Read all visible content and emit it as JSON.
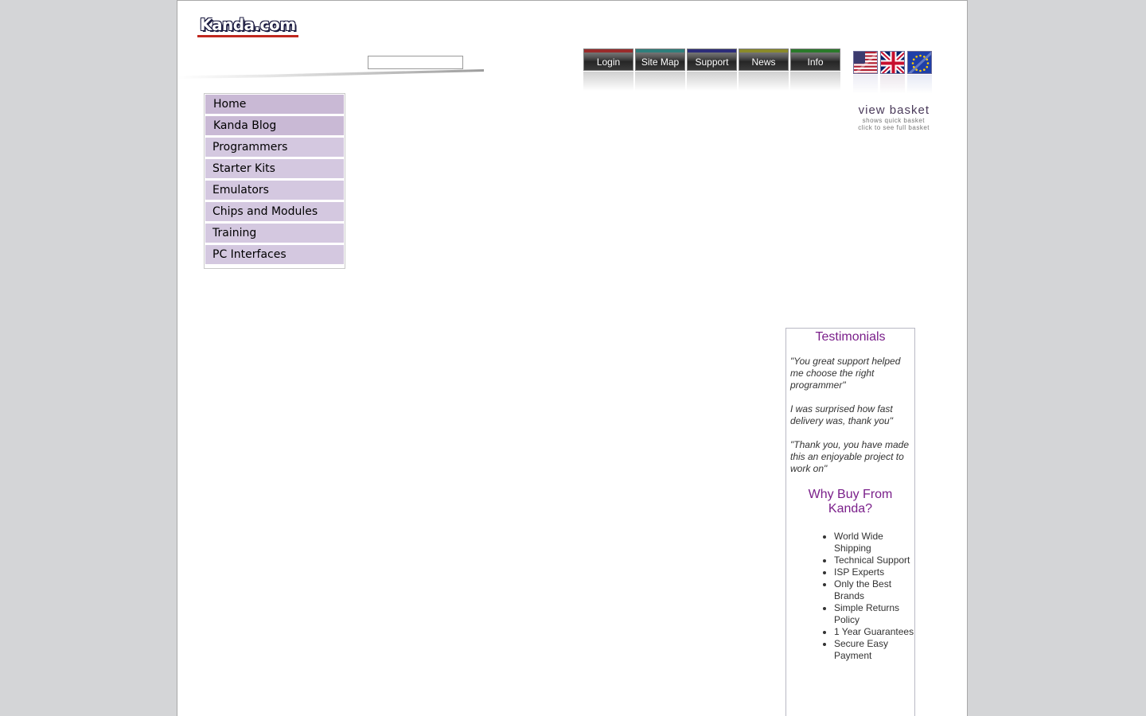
{
  "header": {
    "logo_text": "Kanda.com",
    "search_value": ""
  },
  "topnav": [
    {
      "label": "Login",
      "accent": "#9a2b2b"
    },
    {
      "label": "Site Map",
      "accent": "#2f7f7c"
    },
    {
      "label": "Support",
      "accent": "#2c2c7a"
    },
    {
      "label": "News",
      "accent": "#8a8a2a"
    },
    {
      "label": "Info",
      "accent": "#2a7a2a"
    }
  ],
  "flags": [
    {
      "icon": "us-flag-icon"
    },
    {
      "icon": "uk-flag-icon"
    },
    {
      "icon": "eu-flag-icon"
    }
  ],
  "basket": {
    "title": "view basket",
    "line1": "shows quick basket",
    "line2": "click to see full basket"
  },
  "menu": {
    "items": [
      "Home",
      "Kanda Blog",
      "Programmers",
      "Starter Kits",
      "Emulators",
      "Chips and Modules",
      "Training",
      "PC Interfaces"
    ]
  },
  "testimonials": {
    "heading": "Testimonials",
    "quotes": [
      "\"You great support helped me choose the right programmer\"",
      "I was surprised how fast delivery was, thank you\"",
      "\"Thank you, you have made this an enjoyable project to work on\""
    ]
  },
  "why": {
    "heading": "Why Buy From Kanda?",
    "items": [
      "World Wide Shipping",
      "Technical Support",
      "ISP Experts",
      "Only the Best Brands",
      "Simple Returns Policy",
      "1 Year Guarantees",
      "Secure Easy Payment"
    ]
  },
  "colors": {
    "menu_bg": "#d4c8e0",
    "heading_purple": "#7a1f8a"
  }
}
